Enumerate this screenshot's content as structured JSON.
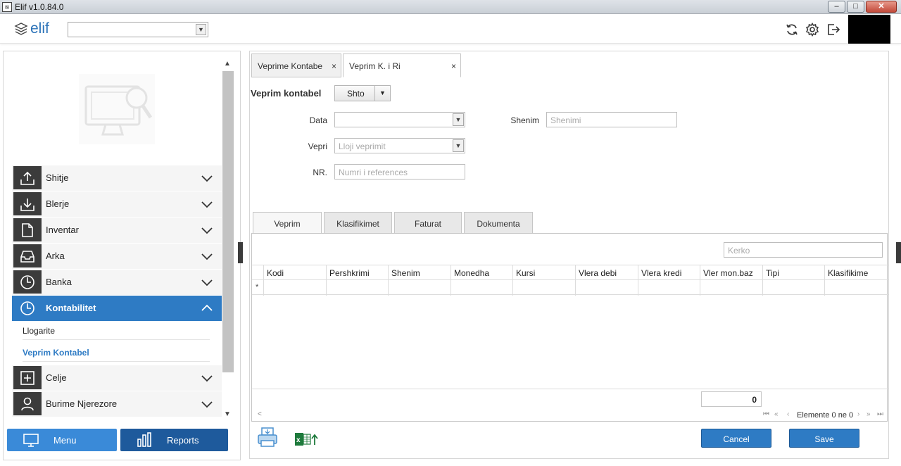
{
  "window": {
    "title": "Elif v1.0.84.0"
  },
  "topbar": {
    "logo_text": "elif",
    "company_select_value": "",
    "icons": [
      "refresh-icon",
      "gear-icon",
      "logout-icon"
    ]
  },
  "sidebar": {
    "menu": [
      {
        "label": "Shitje",
        "icon": "upload-icon"
      },
      {
        "label": "Blerje",
        "icon": "download-icon"
      },
      {
        "label": "Inventar",
        "icon": "document-icon"
      },
      {
        "label": "Arka",
        "icon": "inbox-icon"
      },
      {
        "label": "Banka",
        "icon": "clock-icon"
      },
      {
        "label": "Kontabilitet",
        "icon": "clock-icon",
        "active": true
      },
      {
        "label": "Celje",
        "icon": "plus-box-icon"
      },
      {
        "label": "Burime Njerezore",
        "icon": "person-icon"
      }
    ],
    "submenu": [
      {
        "label": "Llogarite"
      },
      {
        "label": "Veprim Kontabel",
        "selected": true
      }
    ],
    "bottom": {
      "menu_label": "Menu",
      "reports_label": "Reports"
    }
  },
  "main": {
    "tabs": [
      {
        "label": "Veprime Kontabe",
        "close": "×"
      },
      {
        "label": "Veprim K. i Ri",
        "close": "×"
      }
    ],
    "form": {
      "title": "Veprim kontabel",
      "shto_label": "Shto",
      "data_label": "Data",
      "data_value": "",
      "vepri_label": "Vepri",
      "vepri_placeholder": "Lloji veprimit",
      "nr_label": "NR.",
      "nr_placeholder": "Numri i references",
      "shenim_label": "Shenim",
      "shenim_placeholder": "Shenimi"
    },
    "subtabs": [
      "Veprim",
      "Klasifikimet",
      "Faturat",
      "Dokumenta"
    ],
    "grid": {
      "search_placeholder": "Kerko",
      "columns": [
        "Kodi",
        "Pershkrimi",
        "Shenim",
        "Monedha",
        "Kursi",
        "Vlera debi",
        "Vlera kredi",
        "Vler mon.baz",
        "Tipi",
        "Klasifikime"
      ],
      "new_row_marker": "*",
      "total": "0",
      "pager_text": "Elemente 0 ne 0"
    },
    "buttons": {
      "cancel": "Cancel",
      "save": "Save"
    }
  }
}
